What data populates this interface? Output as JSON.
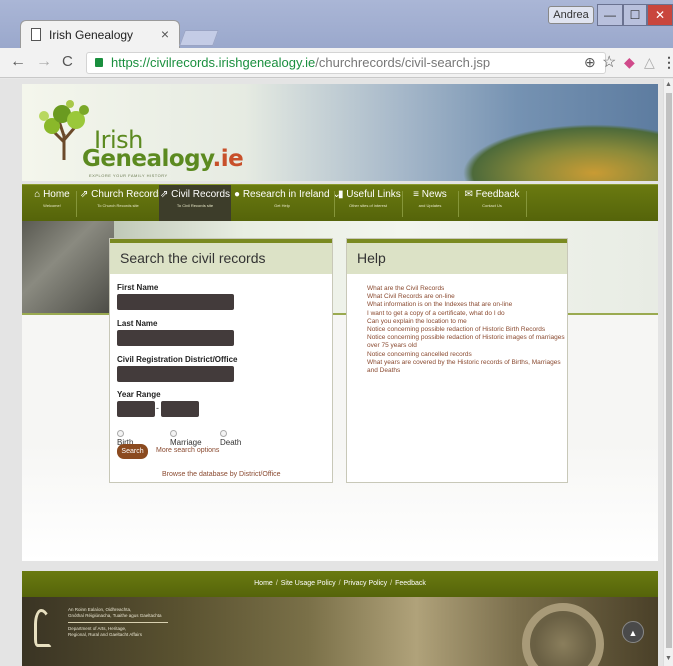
{
  "browser": {
    "tab_title": "Irish Genealogy",
    "tab_close": "×",
    "user": "Andrea",
    "window_buttons": {
      "minimize": "—",
      "maximize": "☐",
      "close": "✕"
    },
    "nav": {
      "back": "←",
      "forward": "→",
      "reload": "C"
    },
    "url_host": "https://civilrecords.irishgenealogy.ie",
    "url_path": "/churchrecords/civil-search.jsp",
    "toolbar_icons": [
      "zoom-icon",
      "star-icon",
      "extension-icon",
      "extension-gray-icon",
      "menu-icon"
    ],
    "toolbar_glyphs": {
      "zoom": "⊕",
      "star": "☆",
      "ext1": "◆",
      "ext2": "△",
      "menu": "⋮"
    }
  },
  "site": {
    "logo": {
      "line1": "Irish",
      "line2": "Genealogy",
      "line2_suffix": ".ie",
      "tagline": "EXPLORE YOUR FAMILY HISTORY"
    },
    "nav": [
      {
        "label": "Home",
        "sub": "Welcome!",
        "glyph": "⌂"
      },
      {
        "label": "Church Records",
        "sub": "To Church Records site",
        "glyph": "⇗"
      },
      {
        "label": "Civil Records",
        "sub": "To Civil Records site",
        "glyph": "⇗"
      },
      {
        "label": "Research in Ireland",
        "sub": "Get Help",
        "glyph": "●",
        "caret": "⌄"
      },
      {
        "label": "Useful Links",
        "sub": "Other sites of interest",
        "glyph": "▮"
      },
      {
        "label": "News",
        "sub": "and Updates",
        "glyph": "≡"
      },
      {
        "label": "Feedback",
        "sub": "Contact Us",
        "glyph": "✉"
      }
    ],
    "search": {
      "title": "Search the civil records",
      "first_name_label": "First Name",
      "last_name_label": "Last Name",
      "district_label": "Civil Registration District/Office",
      "year_range_label": "Year Range",
      "year_sep": "-",
      "types": [
        "Birth",
        "Marriage",
        "Death"
      ],
      "search_button": "Search",
      "more_options": "More search options",
      "browse": "Browse the database by District/Office"
    },
    "help": {
      "title": "Help",
      "links": [
        "What are the Civil Records",
        "What Civil Records are on-line",
        "What information is on the Indexes that are on-line",
        "I want to get a copy of a certificate, what do I do",
        "Can you explain the location to me",
        "Notice concerning possible redaction of Historic Birth Records",
        "Notice concerning possible redaction of Historic images of marriages over 75 years old",
        "Notice concerning cancelled records",
        "What years are covered by the Historic records of Births, Marriages and Deaths"
      ]
    },
    "footer_links": [
      "Home",
      "Site Usage Policy",
      "Privacy Policy",
      "Feedback"
    ],
    "footer_sep": "/",
    "department": {
      "irish_1": "An Roinn Ealaíon, Oidhreachta,",
      "irish_2": "Gnóthaí Réigiúnacha, Tuaithe agus Gaeltachta",
      "english_1": "Department of Arts, Heritage,",
      "english_2": "Regional, Rural and Gaeltacht Affairs"
    },
    "back_to_top": "▲"
  }
}
